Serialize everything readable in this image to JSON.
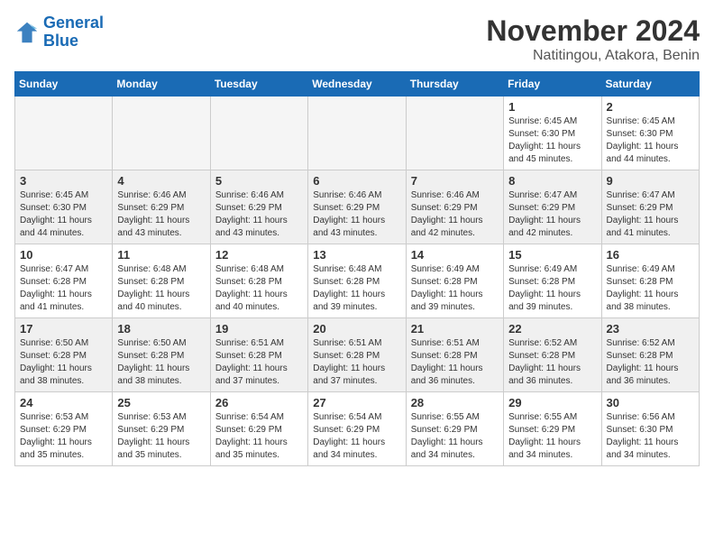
{
  "logo": {
    "line1": "General",
    "line2": "Blue"
  },
  "title": "November 2024",
  "location": "Natitingou, Atakora, Benin",
  "weekdays": [
    "Sunday",
    "Monday",
    "Tuesday",
    "Wednesday",
    "Thursday",
    "Friday",
    "Saturday"
  ],
  "weeks": [
    [
      {
        "day": "",
        "info": ""
      },
      {
        "day": "",
        "info": ""
      },
      {
        "day": "",
        "info": ""
      },
      {
        "day": "",
        "info": ""
      },
      {
        "day": "",
        "info": ""
      },
      {
        "day": "1",
        "info": "Sunrise: 6:45 AM\nSunset: 6:30 PM\nDaylight: 11 hours\nand 45 minutes."
      },
      {
        "day": "2",
        "info": "Sunrise: 6:45 AM\nSunset: 6:30 PM\nDaylight: 11 hours\nand 44 minutes."
      }
    ],
    [
      {
        "day": "3",
        "info": "Sunrise: 6:45 AM\nSunset: 6:30 PM\nDaylight: 11 hours\nand 44 minutes."
      },
      {
        "day": "4",
        "info": "Sunrise: 6:46 AM\nSunset: 6:29 PM\nDaylight: 11 hours\nand 43 minutes."
      },
      {
        "day": "5",
        "info": "Sunrise: 6:46 AM\nSunset: 6:29 PM\nDaylight: 11 hours\nand 43 minutes."
      },
      {
        "day": "6",
        "info": "Sunrise: 6:46 AM\nSunset: 6:29 PM\nDaylight: 11 hours\nand 43 minutes."
      },
      {
        "day": "7",
        "info": "Sunrise: 6:46 AM\nSunset: 6:29 PM\nDaylight: 11 hours\nand 42 minutes."
      },
      {
        "day": "8",
        "info": "Sunrise: 6:47 AM\nSunset: 6:29 PM\nDaylight: 11 hours\nand 42 minutes."
      },
      {
        "day": "9",
        "info": "Sunrise: 6:47 AM\nSunset: 6:29 PM\nDaylight: 11 hours\nand 41 minutes."
      }
    ],
    [
      {
        "day": "10",
        "info": "Sunrise: 6:47 AM\nSunset: 6:28 PM\nDaylight: 11 hours\nand 41 minutes."
      },
      {
        "day": "11",
        "info": "Sunrise: 6:48 AM\nSunset: 6:28 PM\nDaylight: 11 hours\nand 40 minutes."
      },
      {
        "day": "12",
        "info": "Sunrise: 6:48 AM\nSunset: 6:28 PM\nDaylight: 11 hours\nand 40 minutes."
      },
      {
        "day": "13",
        "info": "Sunrise: 6:48 AM\nSunset: 6:28 PM\nDaylight: 11 hours\nand 39 minutes."
      },
      {
        "day": "14",
        "info": "Sunrise: 6:49 AM\nSunset: 6:28 PM\nDaylight: 11 hours\nand 39 minutes."
      },
      {
        "day": "15",
        "info": "Sunrise: 6:49 AM\nSunset: 6:28 PM\nDaylight: 11 hours\nand 39 minutes."
      },
      {
        "day": "16",
        "info": "Sunrise: 6:49 AM\nSunset: 6:28 PM\nDaylight: 11 hours\nand 38 minutes."
      }
    ],
    [
      {
        "day": "17",
        "info": "Sunrise: 6:50 AM\nSunset: 6:28 PM\nDaylight: 11 hours\nand 38 minutes."
      },
      {
        "day": "18",
        "info": "Sunrise: 6:50 AM\nSunset: 6:28 PM\nDaylight: 11 hours\nand 38 minutes."
      },
      {
        "day": "19",
        "info": "Sunrise: 6:51 AM\nSunset: 6:28 PM\nDaylight: 11 hours\nand 37 minutes."
      },
      {
        "day": "20",
        "info": "Sunrise: 6:51 AM\nSunset: 6:28 PM\nDaylight: 11 hours\nand 37 minutes."
      },
      {
        "day": "21",
        "info": "Sunrise: 6:51 AM\nSunset: 6:28 PM\nDaylight: 11 hours\nand 36 minutes."
      },
      {
        "day": "22",
        "info": "Sunrise: 6:52 AM\nSunset: 6:28 PM\nDaylight: 11 hours\nand 36 minutes."
      },
      {
        "day": "23",
        "info": "Sunrise: 6:52 AM\nSunset: 6:28 PM\nDaylight: 11 hours\nand 36 minutes."
      }
    ],
    [
      {
        "day": "24",
        "info": "Sunrise: 6:53 AM\nSunset: 6:29 PM\nDaylight: 11 hours\nand 35 minutes."
      },
      {
        "day": "25",
        "info": "Sunrise: 6:53 AM\nSunset: 6:29 PM\nDaylight: 11 hours\nand 35 minutes."
      },
      {
        "day": "26",
        "info": "Sunrise: 6:54 AM\nSunset: 6:29 PM\nDaylight: 11 hours\nand 35 minutes."
      },
      {
        "day": "27",
        "info": "Sunrise: 6:54 AM\nSunset: 6:29 PM\nDaylight: 11 hours\nand 34 minutes."
      },
      {
        "day": "28",
        "info": "Sunrise: 6:55 AM\nSunset: 6:29 PM\nDaylight: 11 hours\nand 34 minutes."
      },
      {
        "day": "29",
        "info": "Sunrise: 6:55 AM\nSunset: 6:29 PM\nDaylight: 11 hours\nand 34 minutes."
      },
      {
        "day": "30",
        "info": "Sunrise: 6:56 AM\nSunset: 6:30 PM\nDaylight: 11 hours\nand 34 minutes."
      }
    ]
  ]
}
